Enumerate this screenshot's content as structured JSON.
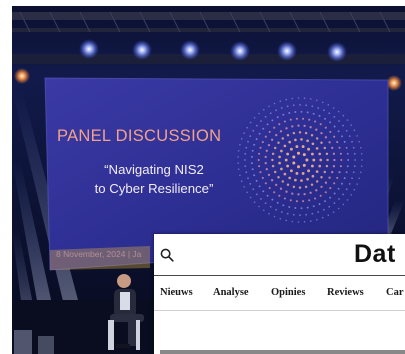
{
  "slide": {
    "title": "PANEL DISCUSSION",
    "quote_line_1": "“Navigating NIS2",
    "quote_line_2": "to Cyber Resilience”",
    "footer": "8 November, 2024 | Ja"
  },
  "website": {
    "logo": "Dat",
    "search_icon": "search-icon",
    "nav": [
      "Nieuws",
      "Analyse",
      "Opinies",
      "Reviews",
      "Car"
    ]
  },
  "colors": {
    "slide_background": "#2a2c8e",
    "slide_title": "#f2a28a",
    "stage_lights": "#5b7bff",
    "website_background": "#ffffff"
  }
}
